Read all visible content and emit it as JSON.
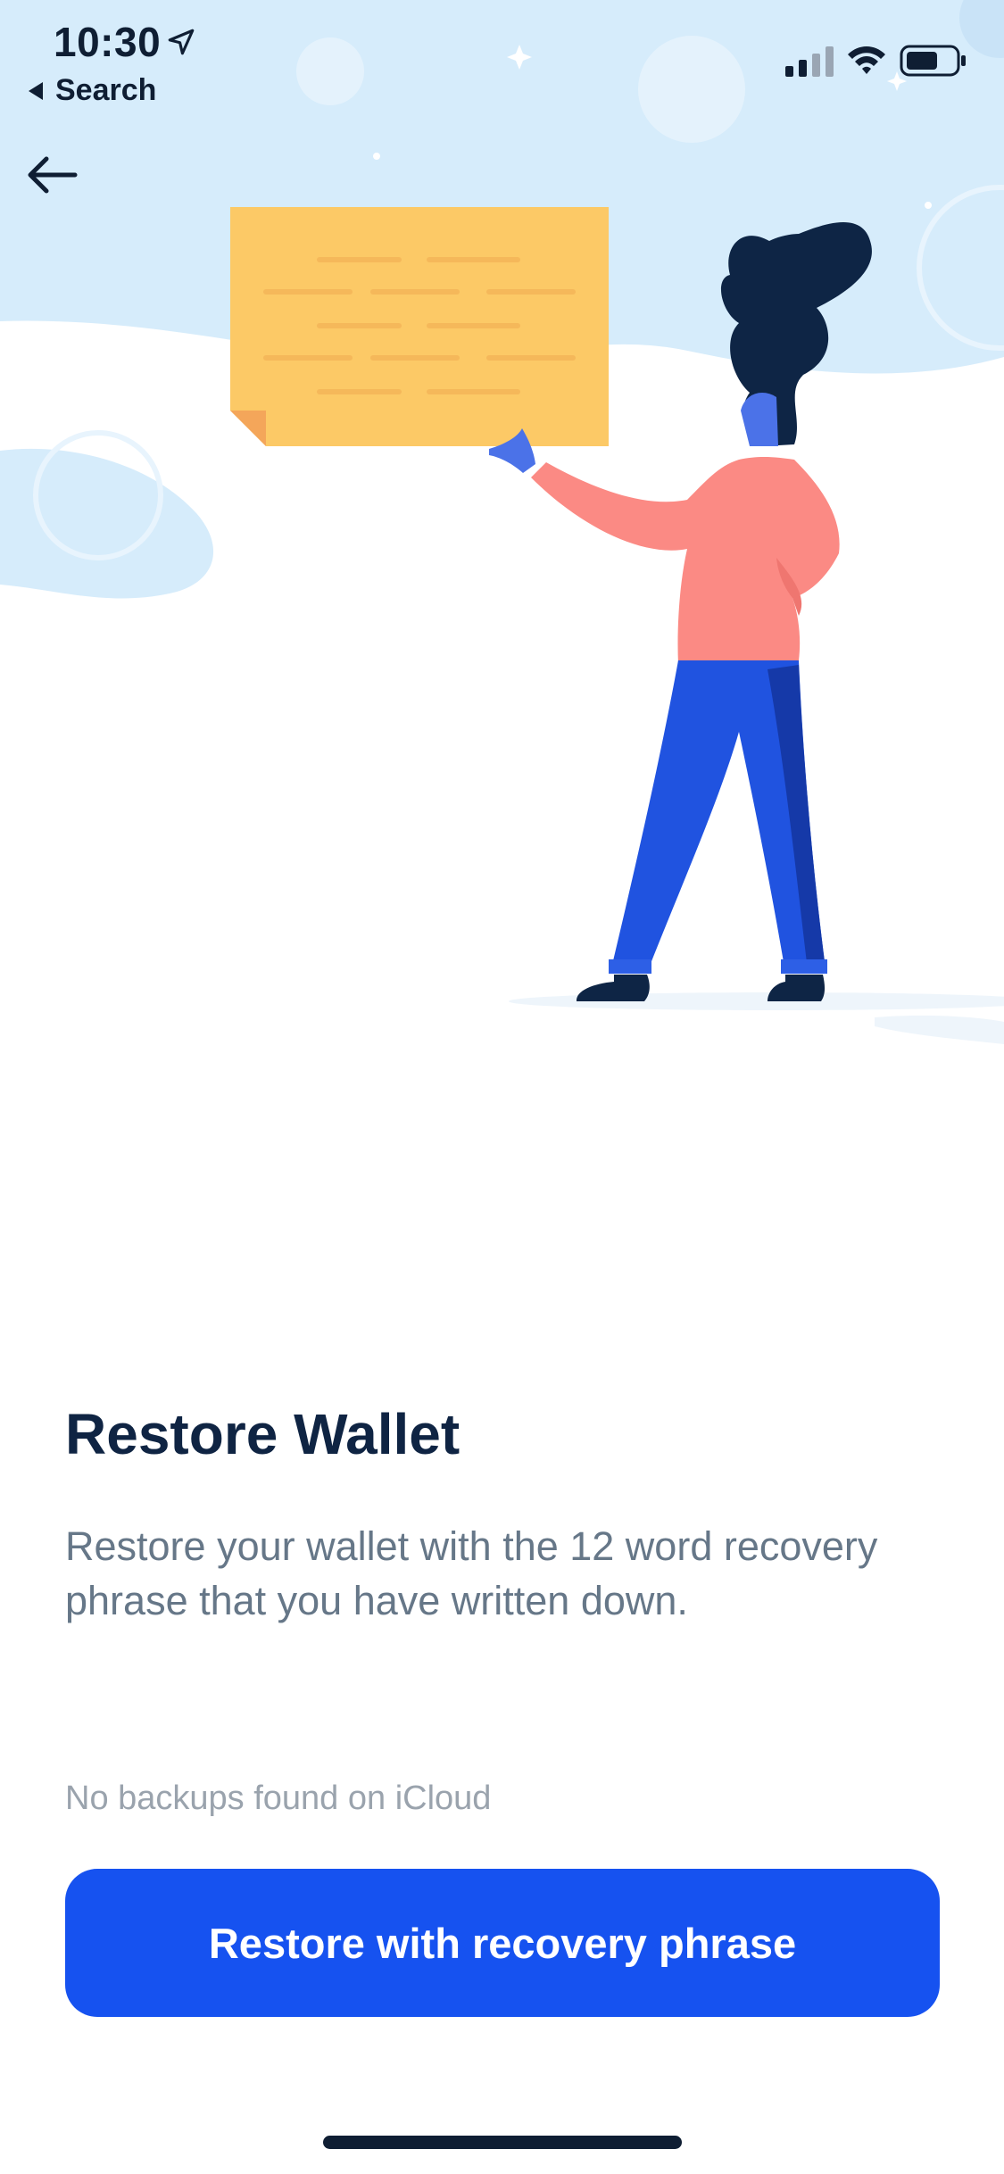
{
  "status_bar": {
    "time": "10:30",
    "back_app_label": "Search"
  },
  "icons": {
    "location": "location-arrow-icon",
    "signal": "cellular-signal-icon",
    "wifi": "wifi-icon",
    "battery": "battery-icon",
    "back": "arrow-left-icon"
  },
  "content": {
    "title": "Restore Wallet",
    "description": "Restore your wallet with the 12 word recovery phrase that you have written down.",
    "backup_status": "No backups found on iCloud",
    "restore_button_label": "Restore with recovery phrase"
  },
  "colors": {
    "primary_button": "#1652f0",
    "title_text": "#0f2443",
    "body_text": "#667788",
    "muted_text": "#9aa3ad",
    "hero_sky": "#d6ecfb"
  }
}
